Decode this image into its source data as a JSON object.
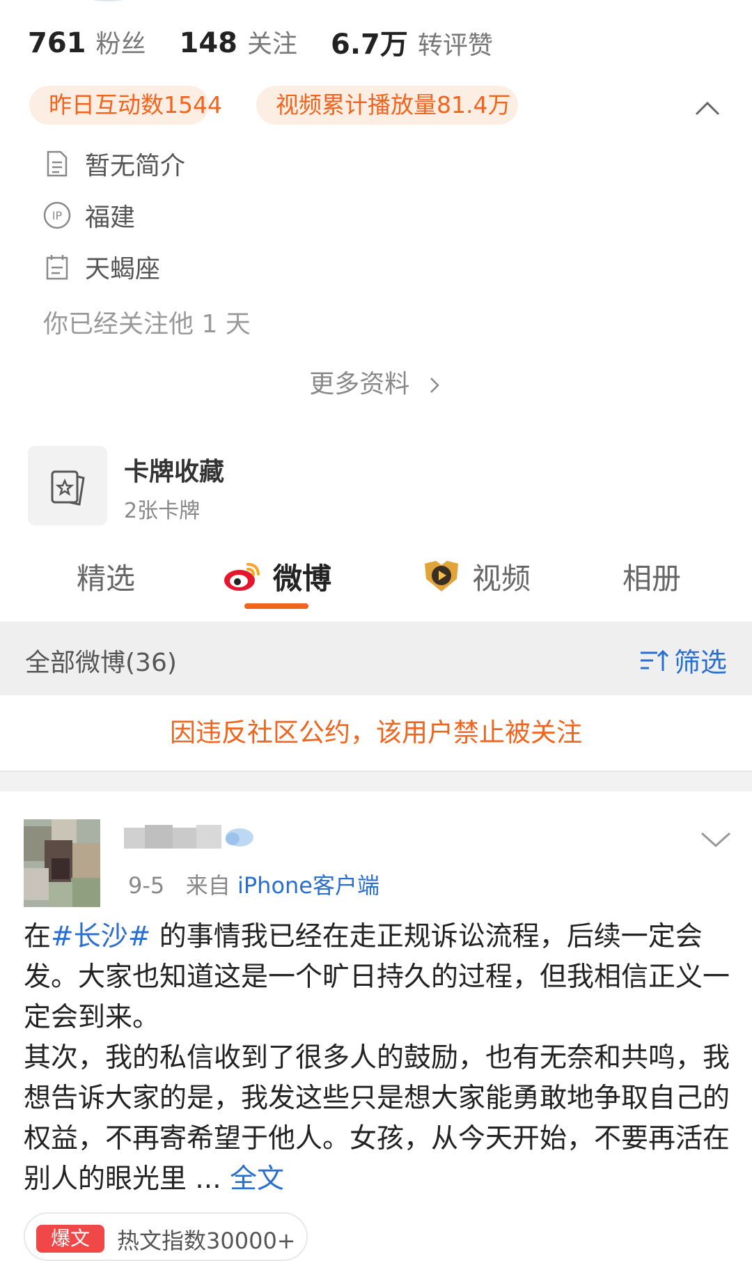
{
  "profile": {
    "stats": [
      {
        "num": "761",
        "label": "粉丝"
      },
      {
        "num": "148",
        "label": "关注"
      },
      {
        "num": "6.7万",
        "label": "转评赞"
      }
    ],
    "badges": [
      "昨日互动数1544",
      "视频累计播放量81.4万"
    ],
    "info": [
      {
        "icon": "document-icon",
        "text": "暂无简介"
      },
      {
        "icon": "ip-location-icon",
        "text": "福建"
      },
      {
        "icon": "calendar-icon",
        "text": "天蝎座"
      }
    ],
    "follow_days": "你已经关注他 1 天",
    "more_info": "更多资料"
  },
  "card": {
    "title": "卡牌收藏",
    "subtitle": "2张卡牌"
  },
  "tabs": [
    {
      "label": "精选",
      "active": false
    },
    {
      "label": "微博",
      "active": true,
      "icon": "weibo-logo-icon"
    },
    {
      "label": "视频",
      "active": false,
      "icon": "video-badge-icon"
    },
    {
      "label": "相册",
      "active": false
    }
  ],
  "feed": {
    "count_label": "全部微博(36)",
    "filter_label": "筛选",
    "notice": "因违反社区公约，该用户禁止被关注"
  },
  "post": {
    "date": "9-5",
    "source_prefix": "来自",
    "source": "iPhone客户端",
    "body_pre": "在",
    "hashtag": "#长沙#",
    "body_main": " 的事情我已经在走正规诉讼流程，后续一定会发。大家也知道这是一个旷日持久的过程，但我相信正义一定会到来。",
    "body_second": "其次，我的私信收到了很多人的鼓励，也有无奈和共鸣，我想告诉大家的是，我发这些只是想大家能勇敢地争取自己的权益，不再寄希望于他人。女孩，从今天开始，不要再活在别人的眼光里",
    "ellipsis": " ... ",
    "full_text": "全文",
    "hot_pill": "爆文",
    "hot_text": "热文指数30000+"
  },
  "colors": {
    "accent_orange": "#f0641e",
    "badge_bg": "#fdeee4",
    "link_blue": "#2a6fd0"
  }
}
